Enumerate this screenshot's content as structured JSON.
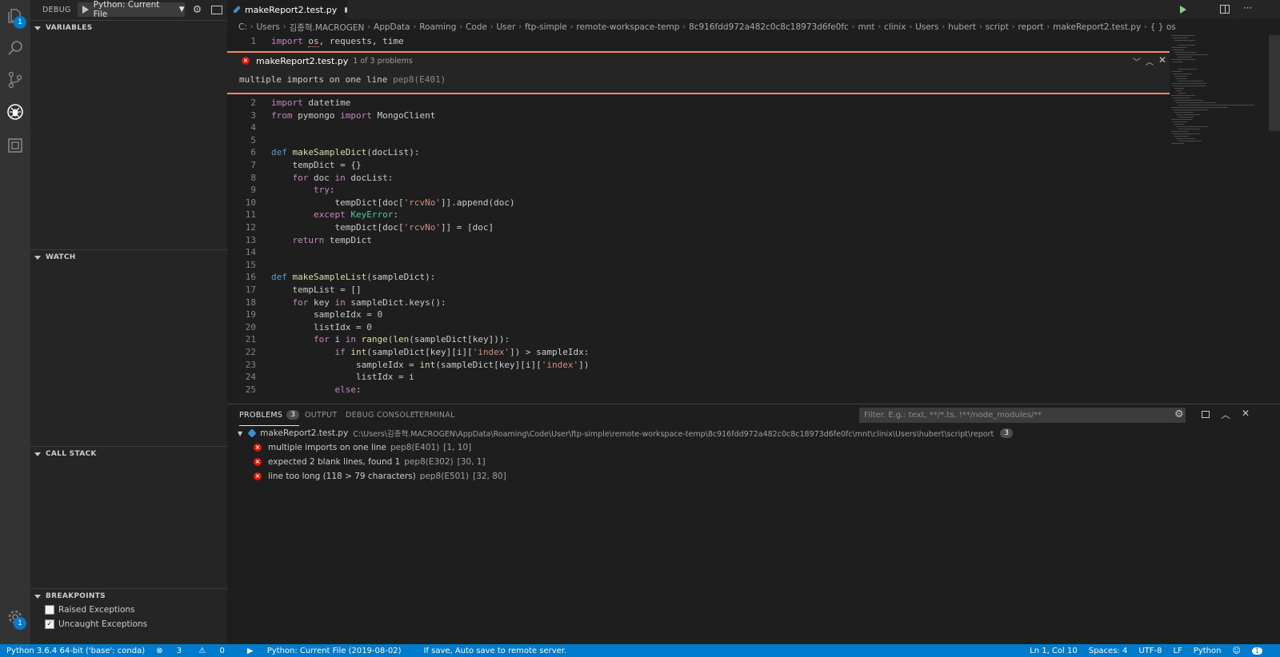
{
  "activity": {
    "explorer_badge": "1",
    "settings_badge": "1"
  },
  "debug": {
    "title": "DEBUG",
    "config": "Python: Current File"
  },
  "sections": {
    "variables": "VARIABLES",
    "watch": "WATCH",
    "call_stack": "CALL STACK",
    "breakpoints": "BREAKPOINTS"
  },
  "breakpoints": [
    {
      "label": "Raised Exceptions",
      "checked": false
    },
    {
      "label": "Uncaught Exceptions",
      "checked": true
    }
  ],
  "tab": {
    "name": "makeReport2.test.py"
  },
  "breadcrumb": [
    "C:",
    "Users",
    "김종혁.MACROGEN",
    "AppData",
    "Roaming",
    "Code",
    "User",
    "ftp-simple",
    "remote-workspace-temp",
    "8c916fdd972a482c0c8c18973d6fe0fc",
    "mnt",
    "clinix",
    "Users",
    "hubert",
    "script",
    "report",
    "makeReport2.test.py",
    "{ } os"
  ],
  "code": {
    "line1": {
      "num": "1",
      "text": "import os, requests, time"
    }
  },
  "peek": {
    "file": "makeReport2.test.py",
    "count": "1 of 3 problems",
    "message": "multiple imports on one line",
    "code": "pep8(E401)"
  },
  "code_lines": [
    {
      "num": "2",
      "text": "import datetime"
    },
    {
      "num": "3",
      "text": "from pymongo import MongoClient"
    },
    {
      "num": "4",
      "text": ""
    },
    {
      "num": "5",
      "text": ""
    },
    {
      "num": "6",
      "text": "def makeSampleDict(docList):"
    },
    {
      "num": "7",
      "text": "    tempDict = {}"
    },
    {
      "num": "8",
      "text": "    for doc in docList:"
    },
    {
      "num": "9",
      "text": "        try:"
    },
    {
      "num": "10",
      "text": "            tempDict[doc['rcvNo']].append(doc)"
    },
    {
      "num": "11",
      "text": "        except KeyError:"
    },
    {
      "num": "12",
      "text": "            tempDict[doc['rcvNo']] = [doc]"
    },
    {
      "num": "13",
      "text": "    return tempDict"
    },
    {
      "num": "14",
      "text": ""
    },
    {
      "num": "15",
      "text": ""
    },
    {
      "num": "16",
      "text": "def makeSampleList(sampleDict):"
    },
    {
      "num": "17",
      "text": "    tempList = []"
    },
    {
      "num": "18",
      "text": "    for key in sampleDict.keys():"
    },
    {
      "num": "19",
      "text": "        sampleIdx = 0"
    },
    {
      "num": "20",
      "text": "        listIdx = 0"
    },
    {
      "num": "21",
      "text": "        for i in range(len(sampleDict[key])):"
    },
    {
      "num": "22",
      "text": "            if int(sampleDict[key][i]['index']) > sampleIdx:"
    },
    {
      "num": "23",
      "text": "                sampleIdx = int(sampleDict[key][i]['index'])"
    },
    {
      "num": "24",
      "text": "                listIdx = i"
    },
    {
      "num": "25",
      "text": "            else:"
    }
  ],
  "panel": {
    "tabs": [
      "PROBLEMS",
      "OUTPUT",
      "DEBUG CONSOLE",
      "TERMINAL"
    ],
    "problems_count": "3",
    "filter_placeholder": "Filter. E.g.: text, **/*.ts, !**/node_modules/**",
    "file": "makeReport2.test.py",
    "path": "C:\\Users\\김종혁.MACROGEN\\AppData\\Roaming\\Code\\User\\ftp-simple\\remote-workspace-temp\\8c916fdd972a482c0c8c18973d6fe0fc\\mnt\\clinix\\Users\\hubert\\script\\report",
    "file_count": "3",
    "problems": [
      {
        "message": "multiple imports on one line",
        "source": "pep8(E401)",
        "pos": "[1, 10]"
      },
      {
        "message": "expected 2 blank lines, found 1",
        "source": "pep8(E302)",
        "pos": "[30, 1]"
      },
      {
        "message": "line too long (118 > 79 characters)",
        "source": "pep8(E501)",
        "pos": "[32, 80]"
      }
    ]
  },
  "status": {
    "interpreter": "Python 3.6.4 64-bit ('base': conda)",
    "errors": "3",
    "warnings": "0",
    "debug_config": "Python: Current File (2019-08-02)",
    "message": "If save, Auto save to remote server.",
    "position": "Ln 1, Col 10",
    "spaces": "Spaces: 4",
    "encoding": "UTF-8",
    "eol": "LF",
    "language": "Python",
    "notif_badge": "1"
  },
  "colors": {
    "accent": "#007acc",
    "error": "#e51400",
    "peek_border": "#f48771"
  }
}
